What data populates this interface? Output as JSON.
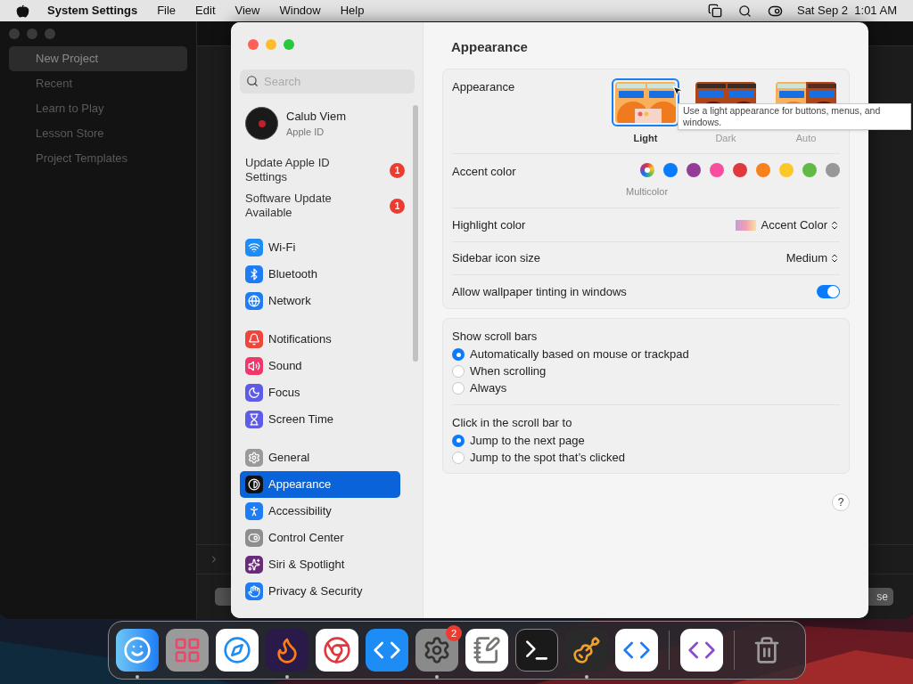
{
  "menubar": {
    "app_name": "System Settings",
    "menus": [
      "File",
      "Edit",
      "View",
      "Window",
      "Help"
    ],
    "clock": "Sat Sep 2  1:01 AM"
  },
  "back_window": {
    "sidebar": [
      {
        "label": "New Project",
        "selected": true
      },
      {
        "label": "Recent",
        "selected": false
      },
      {
        "label": "Learn to Play",
        "selected": false
      },
      {
        "label": "Lesson Store",
        "selected": false
      },
      {
        "label": "Project Templates",
        "selected": false
      }
    ],
    "buttons": [
      "se"
    ]
  },
  "settings": {
    "search": {
      "placeholder": "Search"
    },
    "account": {
      "name": "Calub Viem",
      "subtitle": "Apple ID"
    },
    "notices": [
      {
        "label": "Update Apple ID Settings",
        "count": "1"
      },
      {
        "label": "Software Update Available",
        "count": "1"
      }
    ],
    "groups": [
      [
        {
          "label": "Wi-Fi",
          "kind": "wifi",
          "selected": false
        },
        {
          "label": "Bluetooth",
          "kind": "bluetooth",
          "selected": false
        },
        {
          "label": "Network",
          "kind": "network",
          "selected": false
        }
      ],
      [
        {
          "label": "Notifications",
          "kind": "notifications",
          "selected": false
        },
        {
          "label": "Sound",
          "kind": "sound",
          "selected": false
        },
        {
          "label": "Focus",
          "kind": "focus",
          "selected": false
        },
        {
          "label": "Screen Time",
          "kind": "screentime",
          "selected": false
        }
      ],
      [
        {
          "label": "General",
          "kind": "general",
          "selected": false
        },
        {
          "label": "Appearance",
          "kind": "appearance",
          "selected": true
        },
        {
          "label": "Accessibility",
          "kind": "accessibility",
          "selected": false
        },
        {
          "label": "Control Center",
          "kind": "controlcenter",
          "selected": false
        },
        {
          "label": "Siri & Spotlight",
          "kind": "siri",
          "selected": false
        },
        {
          "label": "Privacy & Security",
          "kind": "privacy",
          "selected": false
        }
      ]
    ],
    "title": "Appearance",
    "appearance": {
      "label": "Appearance",
      "options": [
        {
          "label": "Light",
          "kind": "light",
          "selected": true
        },
        {
          "label": "Dark",
          "kind": "dark",
          "selected": false
        },
        {
          "label": "Auto",
          "kind": "auto",
          "selected": false
        }
      ],
      "tooltip": "Use a light appearance for buttons, menus, and windows."
    },
    "accent": {
      "label": "Accent color",
      "selected_name": "Multicolor",
      "colors": [
        {
          "kind": "multicolor",
          "selected": true
        },
        {
          "kind": "solid",
          "color": "#0a7aff",
          "selected": false
        },
        {
          "kind": "solid",
          "color": "#953d96",
          "selected": false
        },
        {
          "kind": "solid",
          "color": "#f74f9e",
          "selected": false
        },
        {
          "kind": "solid",
          "color": "#e0383e",
          "selected": false
        },
        {
          "kind": "solid",
          "color": "#f7821b",
          "selected": false
        },
        {
          "kind": "solid",
          "color": "#fcc827",
          "selected": false
        },
        {
          "kind": "solid",
          "color": "#62ba46",
          "selected": false
        },
        {
          "kind": "solid",
          "color": "#989898",
          "selected": false
        }
      ]
    },
    "highlight": {
      "label": "Highlight color",
      "value": "Accent Color"
    },
    "icon_size": {
      "label": "Sidebar icon size",
      "value": "Medium"
    },
    "tinting": {
      "label": "Allow wallpaper tinting in windows",
      "on": true
    },
    "scroll_groups": [
      {
        "label": "Show scroll bars",
        "options": [
          {
            "label": "Automatically based on mouse or trackpad",
            "selected": true
          },
          {
            "label": "When scrolling",
            "selected": false
          },
          {
            "label": "Always",
            "selected": false
          }
        ]
      },
      {
        "label": "Click in the scroll bar to",
        "options": [
          {
            "label": "Jump to the next page",
            "selected": true
          },
          {
            "label": "Jump to the spot that’s clicked",
            "selected": false
          }
        ]
      }
    ],
    "help": "?"
  },
  "dock": {
    "items": [
      {
        "kind": "finder",
        "running": true
      },
      {
        "kind": "launchpad",
        "running": false
      },
      {
        "kind": "safari",
        "running": false
      },
      {
        "kind": "firefox",
        "running": true
      },
      {
        "kind": "chrome",
        "running": false
      },
      {
        "kind": "appstore",
        "running": false
      },
      {
        "kind": "settings",
        "running": true,
        "badge": "2"
      },
      {
        "kind": "textedit",
        "running": false
      },
      {
        "kind": "terminal",
        "running": false
      },
      {
        "kind": "garageband",
        "running": true
      },
      {
        "kind": "vscode",
        "running": false
      },
      {
        "kind": "separator"
      },
      {
        "kind": "visualstudio",
        "running": false
      },
      {
        "kind": "separator"
      },
      {
        "kind": "trash",
        "running": false
      }
    ]
  }
}
